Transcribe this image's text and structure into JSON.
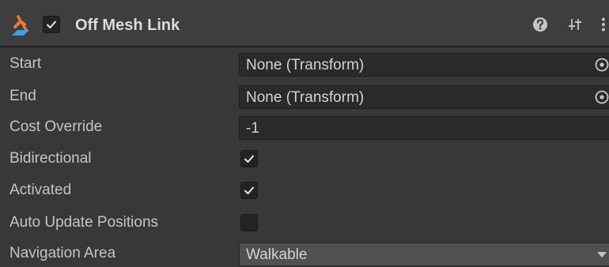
{
  "header": {
    "title": "Off Mesh Link",
    "enabled": true,
    "icons": [
      "off-mesh-link-component-icon",
      "help-icon",
      "presets-icon",
      "kebab-menu-icon"
    ]
  },
  "properties": {
    "start": {
      "label": "Start",
      "value": "None (Transform)"
    },
    "end": {
      "label": "End",
      "value": "None (Transform)"
    },
    "cost_override": {
      "label": "Cost Override",
      "value": "-1"
    },
    "bidirectional": {
      "label": "Bidirectional",
      "checked": true
    },
    "activated": {
      "label": "Activated",
      "checked": true
    },
    "auto_update_positions": {
      "label": "Auto Update Positions",
      "checked": false
    },
    "navigation_area": {
      "label": "Navigation Area",
      "value": "Walkable"
    }
  },
  "colors": {
    "background": "#383838",
    "header": "#3e3e3e",
    "field": "#2a2a2a",
    "text": "#c4c4c4",
    "icon_orange": "#f07828",
    "icon_blue": "#3c9ee0"
  }
}
